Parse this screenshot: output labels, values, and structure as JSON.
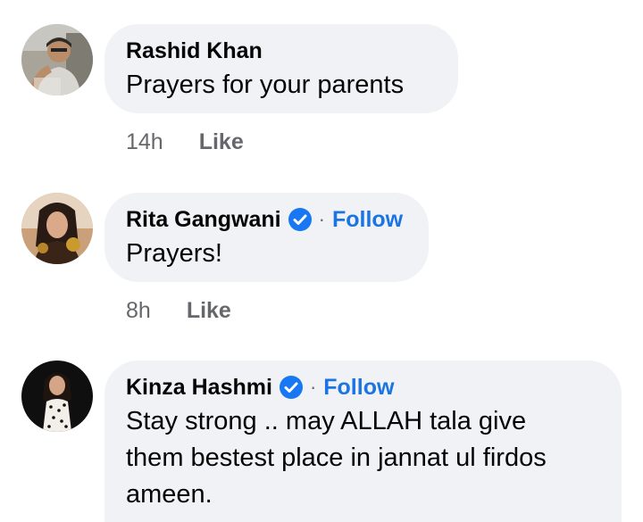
{
  "comments": [
    {
      "author": "Rashid Khan",
      "verified": false,
      "text": "Prayers for your parents",
      "time": "14h",
      "like_label": "Like"
    },
    {
      "author": "Rita Gangwani",
      "verified": true,
      "follow_separator": "·",
      "follow_label": "Follow",
      "text": "Prayers!",
      "time": "8h",
      "like_label": "Like"
    },
    {
      "author": "Kinza Hashmi",
      "verified": true,
      "follow_separator": "·",
      "follow_label": "Follow",
      "text_lines": [
        "Stay strong .. may ALLAH tala give",
        "them bestest place in jannat ul firdos",
        "ameen."
      ]
    }
  ],
  "colors": {
    "bubble_bg": "#f0f2f5",
    "follow_blue": "#1b74e4",
    "meta_gray": "#65676b",
    "verified_blue": "#1877f2"
  },
  "icons": {
    "verified": "verified-badge-icon"
  }
}
